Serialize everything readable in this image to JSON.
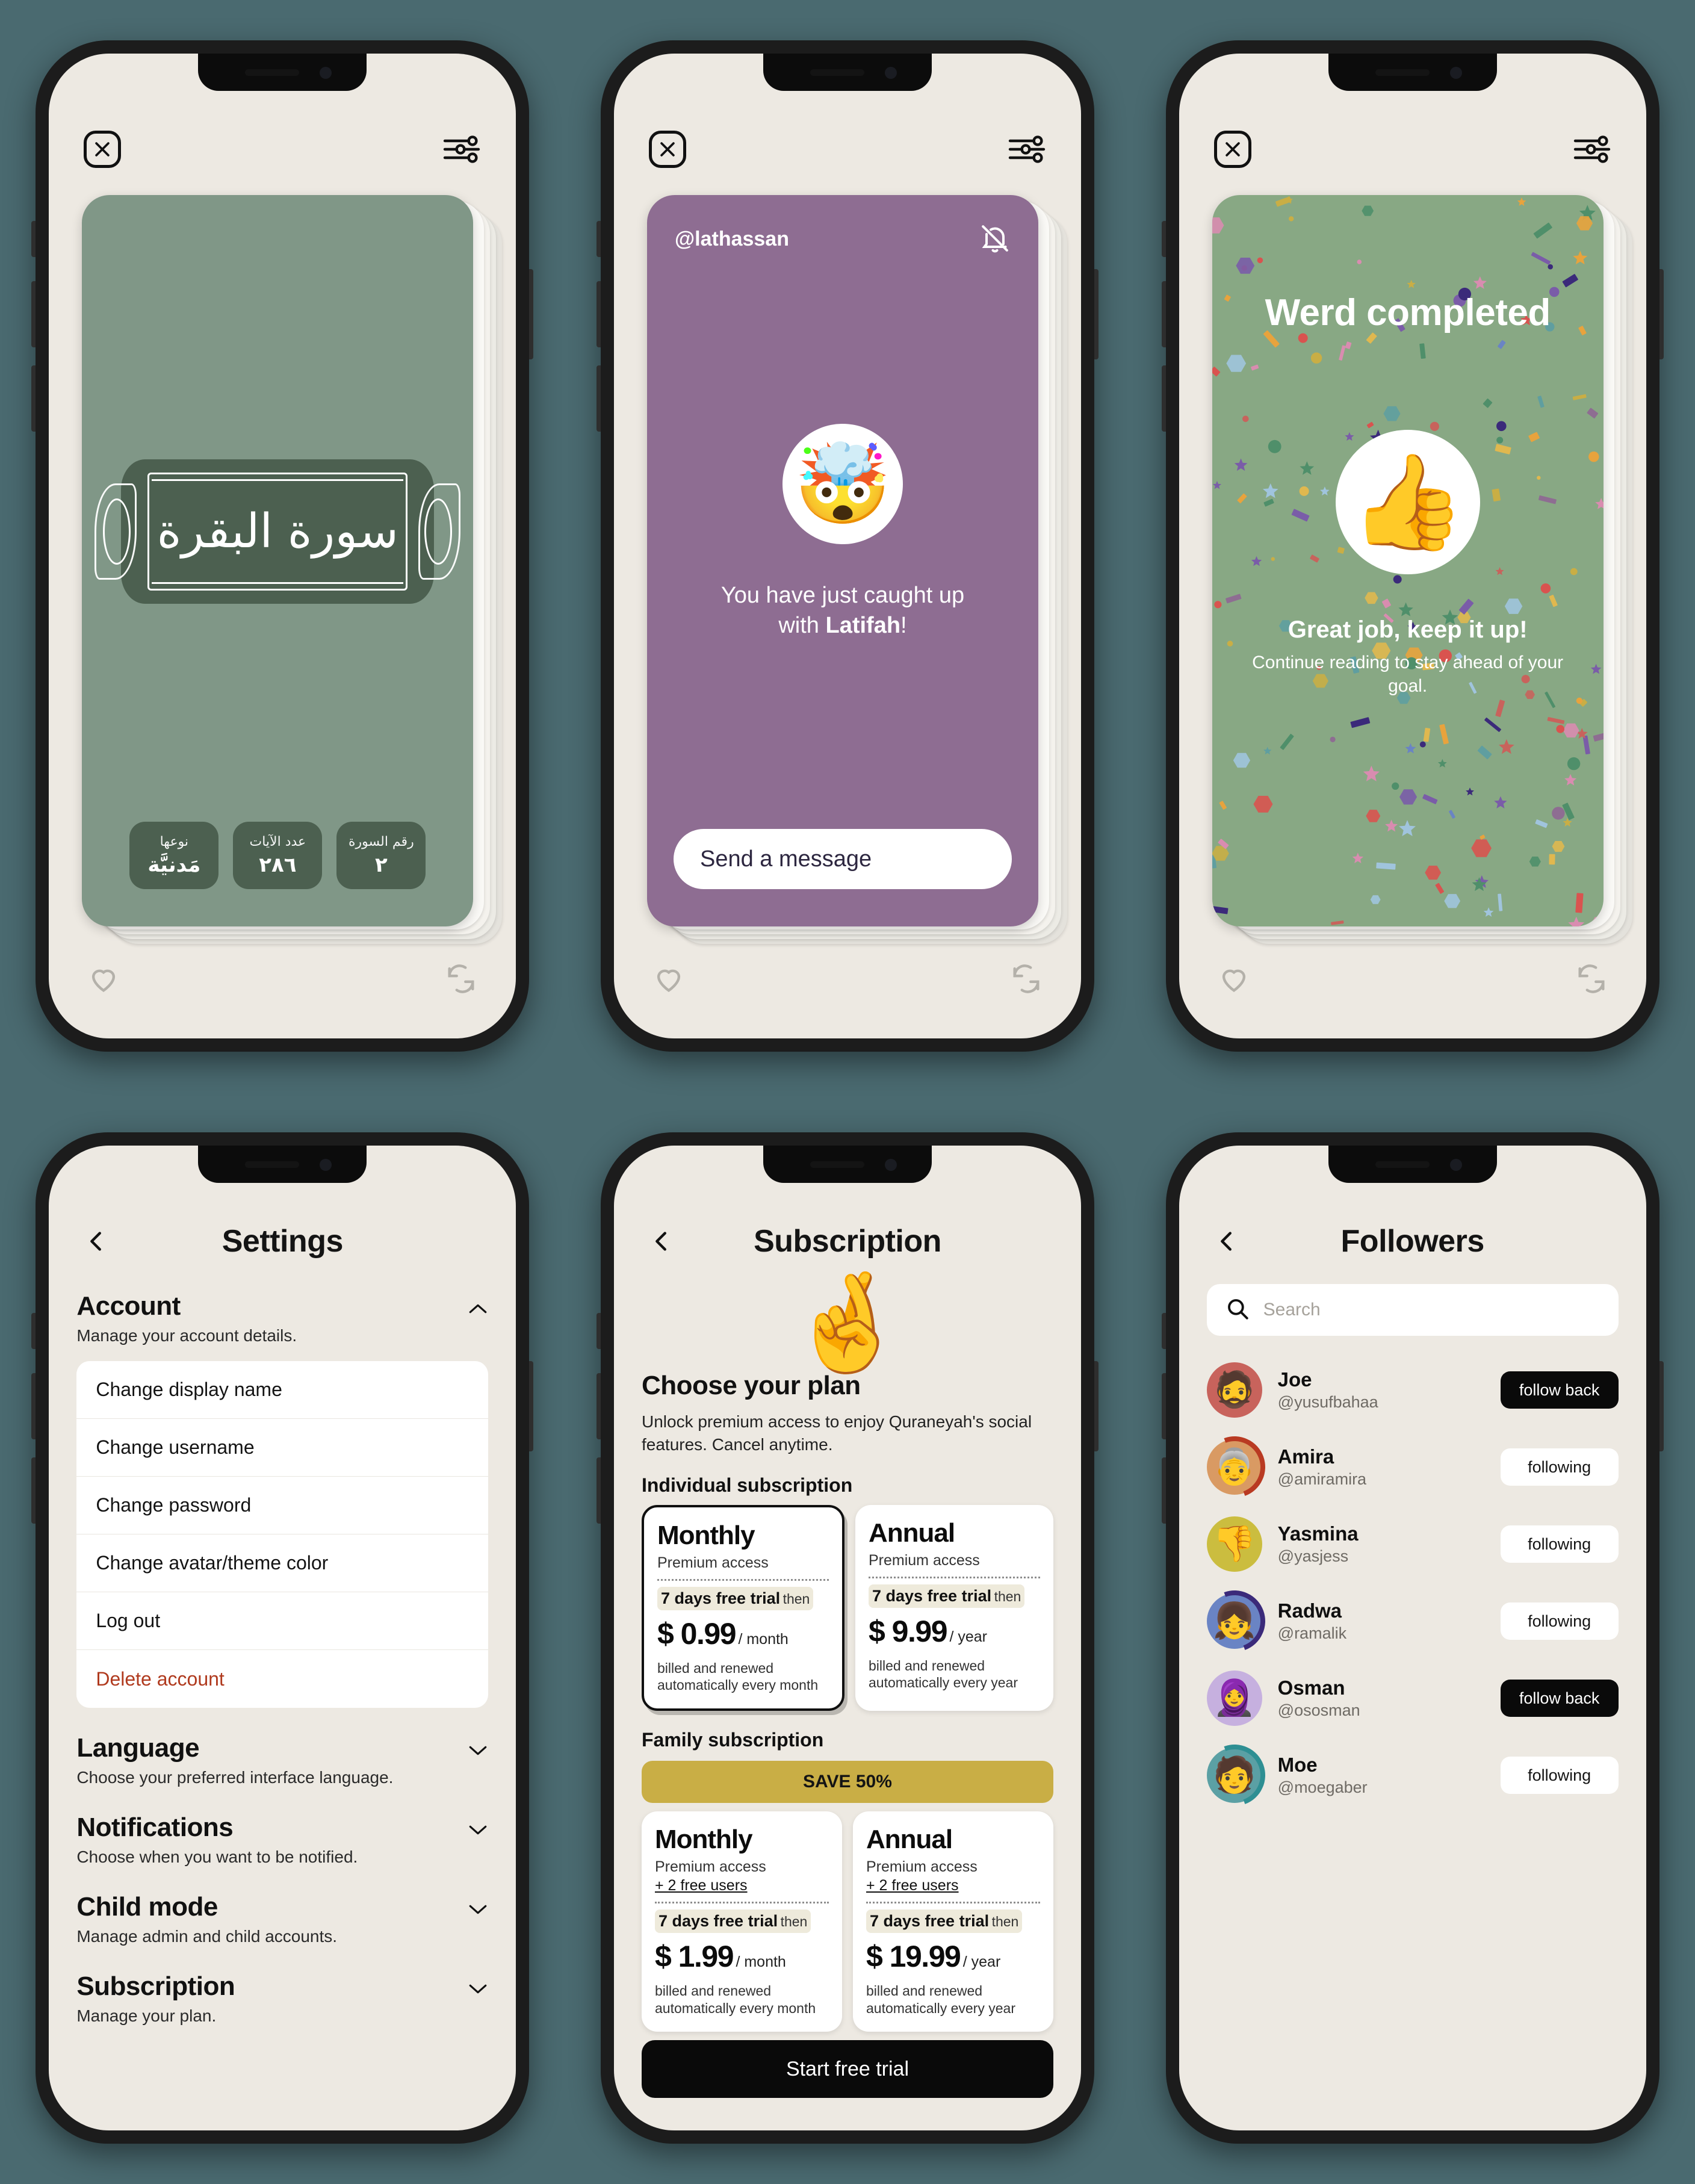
{
  "theme": {
    "page_bg": "#4a6a70",
    "screen_bg": "#ede9e2",
    "story_green": "#809787",
    "story_purple": "#8e6d92",
    "story_confetti_bg": "#88a884",
    "plaque_green": "#4c6050",
    "accent_gold": "#c9ae45",
    "danger_red": "#b03a1e",
    "black": "#0a0a0a"
  },
  "screen1": {
    "name": "surah-story",
    "close_icon": "close-x-icon",
    "settings_icon": "sliders-icon",
    "calligraphy": "سورة البقرة",
    "chips": [
      {
        "key": "نوعها",
        "value": "مَدنيَّة"
      },
      {
        "key": "عدد الآيات",
        "value": "٢٨٦"
      },
      {
        "key": "رقم السورة",
        "value": "٢"
      }
    ],
    "bottom": {
      "like_icon": "heart-icon",
      "repost_icon": "repost-icon"
    }
  },
  "screen2": {
    "name": "caught-up-story",
    "close_icon": "close-x-icon",
    "settings_icon": "sliders-icon",
    "handle": "@lathassan",
    "mute_icon": "bell-off-icon",
    "avatar_emoji": "🤯",
    "message_line1": "You have just caught up",
    "message_line2_prefix": "with ",
    "message_name": "Latifah",
    "message_suffix": "!",
    "send_button": "Send a message",
    "bottom": {
      "like_icon": "heart-icon",
      "repost_icon": "repost-icon"
    }
  },
  "screen3": {
    "name": "werd-completed-story",
    "close_icon": "close-x-icon",
    "settings_icon": "sliders-icon",
    "title": "Werd completed",
    "avatar_emoji": "👍",
    "subtitle": "Great job, keep it up!",
    "body": "Continue reading to stay ahead of your goal.",
    "bottom": {
      "like_icon": "heart-icon",
      "repost_icon": "repost-icon"
    }
  },
  "screen4": {
    "name": "settings-screen",
    "back_icon": "chevron-left-icon",
    "title": "Settings",
    "sections": [
      {
        "title": "Account",
        "desc": "Manage your account details.",
        "chevron": "chevron-up-icon",
        "expanded": true,
        "items": [
          {
            "label": "Change display name",
            "danger": false
          },
          {
            "label": "Change username",
            "danger": false
          },
          {
            "label": "Change password",
            "danger": false
          },
          {
            "label": "Change avatar/theme color",
            "danger": false
          },
          {
            "label": "Log out",
            "danger": false
          },
          {
            "label": "Delete account",
            "danger": true
          }
        ]
      },
      {
        "title": "Language",
        "desc": "Choose your preferred interface language.",
        "chevron": "chevron-down-icon",
        "expanded": false,
        "items": []
      },
      {
        "title": "Notifications",
        "desc": "Choose when you want to be notified.",
        "chevron": "chevron-down-icon",
        "expanded": false,
        "items": []
      },
      {
        "title": "Child mode",
        "desc": "Manage admin and child accounts.",
        "chevron": "chevron-down-icon",
        "expanded": false,
        "items": []
      },
      {
        "title": "Subscription",
        "desc": "Manage your plan.",
        "chevron": "chevron-down-icon",
        "expanded": false,
        "items": []
      }
    ]
  },
  "screen5": {
    "name": "subscription-screen",
    "back_icon": "chevron-left-icon",
    "title": "Subscription",
    "hero_emoji": "🤞",
    "heading": "Choose your plan",
    "description": "Unlock premium access to enjoy Quraneyah's social features. Cancel anytime.",
    "individual_label": "Individual subscription",
    "family_label": "Family subscription",
    "save_badge": "SAVE 50%",
    "cta": "Start free trial",
    "individual_plans": [
      {
        "name": "Monthly",
        "access": "Premium access",
        "extra": "",
        "trial": "7 days free trial",
        "then": "then",
        "price": "$ 0.99",
        "period": "/ month",
        "billed": "billed and renewed automatically every month",
        "selected": true
      },
      {
        "name": "Annual",
        "access": "Premium access",
        "extra": "",
        "trial": "7 days free trial",
        "then": "then",
        "price": "$ 9.99",
        "period": "/ year",
        "billed": "billed and renewed automatically every year",
        "selected": false
      }
    ],
    "family_plans": [
      {
        "name": "Monthly",
        "access": "Premium access",
        "extra": "+ 2 free users",
        "trial": "7 days free trial",
        "then": "then",
        "price": "$ 1.99",
        "period": "/ month",
        "billed": "billed and renewed automatically every month",
        "selected": false
      },
      {
        "name": "Annual",
        "access": "Premium access",
        "extra": "+ 2 free users",
        "trial": "7 days free trial",
        "then": "then",
        "price": "$ 19.99",
        "period": "/ year",
        "billed": "billed and renewed automatically every year",
        "selected": false
      }
    ]
  },
  "screen6": {
    "name": "followers-screen",
    "back_icon": "chevron-left-icon",
    "title": "Followers",
    "search_placeholder": "Search",
    "search_icon": "search-icon",
    "followers": [
      {
        "name": "Joe",
        "username": "@yusufbahaa",
        "action": "follow back",
        "state": "dark",
        "emoji": "🧔",
        "bg": "#c8635c",
        "ring": ""
      },
      {
        "name": "Amira",
        "username": "@amiramira",
        "action": "following",
        "state": "light",
        "emoji": "👵",
        "bg": "#d99a63",
        "ring": "#b93a22"
      },
      {
        "name": "Yasmina",
        "username": "@yasjess",
        "action": "following",
        "state": "light",
        "emoji": "👎",
        "bg": "#cbbd3f",
        "ring": ""
      },
      {
        "name": "Radwa",
        "username": "@ramalik",
        "action": "following",
        "state": "light",
        "emoji": "👧",
        "bg": "#6a84c4",
        "ring": "#3b2a7a"
      },
      {
        "name": "Osman",
        "username": "@ososman",
        "action": "follow back",
        "state": "dark",
        "emoji": "🧕",
        "bg": "#c6b0df",
        "ring": ""
      },
      {
        "name": "Moe",
        "username": "@moegaber",
        "action": "following",
        "state": "light",
        "emoji": "🧑",
        "bg": "#5ba0a4",
        "ring": "#2e8f93"
      }
    ]
  }
}
